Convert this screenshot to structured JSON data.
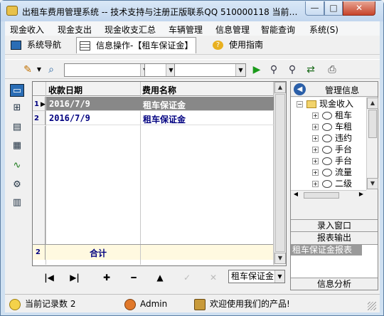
{
  "window": {
    "title": "出租车费用管理系统 -- 技术支持与注册正版联系QQ 510000118  当前…",
    "min": "—",
    "max": "□",
    "close": "✕"
  },
  "menu": [
    "现金收入",
    "现金支出",
    "现金收支汇总",
    "车辆管理",
    "信息管理",
    "智能查询",
    "系统(S)"
  ],
  "tabs": [
    {
      "label": "系统导航"
    },
    {
      "label": "信息操作-【租车保证金】"
    },
    {
      "label": "使用指南"
    }
  ],
  "grid": {
    "headers": [
      "收款日期",
      "费用名称"
    ],
    "rows": [
      {
        "idx": "1",
        "date": "2016/7/9",
        "name": "租车保证金",
        "selected": true
      },
      {
        "idx": "2",
        "date": "2016/7/9",
        "name": "租车保证金",
        "selected": false
      }
    ],
    "summary": {
      "idx": "2",
      "label": "合计"
    }
  },
  "nav": {
    "first": "|◀",
    "prev": "▶|",
    "add": "✚",
    "remove": "━",
    "up": "▲",
    "confirm": "✓",
    "cancel": "✕",
    "combo": "租车保证金"
  },
  "right_panel": {
    "title": "管理信息",
    "tree": {
      "root": "现金收入",
      "children": [
        "租车",
        "车租",
        "违约",
        "手台",
        "手台",
        "流量",
        "二级"
      ]
    },
    "buttons": {
      "entry": "录入窗口",
      "report": "报表输出",
      "analysis": "信息分析"
    },
    "report_items": [
      "租车保证金报表"
    ]
  },
  "status": {
    "records": "当前记录数 2",
    "user": "Admin",
    "welcome": "欢迎使用我们的产品!"
  }
}
